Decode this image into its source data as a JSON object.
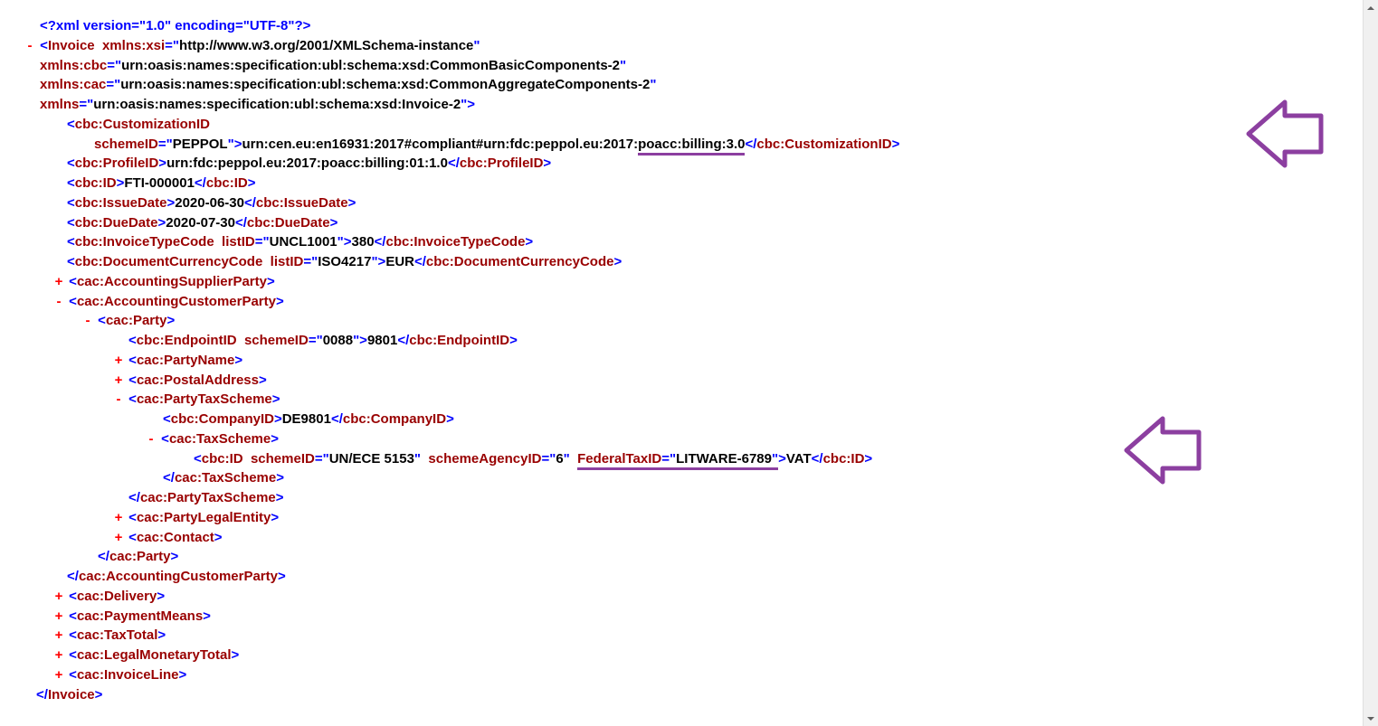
{
  "xml_decl": "<?xml version=\"1.0\" encoding=\"UTF-8\"?>",
  "root": {
    "name": "Invoice",
    "ns": {
      "xsi_attr": "xmlns:xsi",
      "xsi_val": "http://www.w3.org/2001/XMLSchema-instance",
      "cbc_attr": "xmlns:cbc",
      "cbc_val": "urn:oasis:names:specification:ubl:schema:xsd:CommonBasicComponents-2",
      "cac_attr": "xmlns:cac",
      "cac_val": "urn:oasis:names:specification:ubl:schema:xsd:CommonAggregateComponents-2",
      "xmlns_attr": "xmlns",
      "xmlns_val": "urn:oasis:names:specification:ubl:schema:xsd:Invoice-2"
    }
  },
  "customizationID": {
    "open": "cbc:CustomizationID",
    "schemeID_attr": "schemeID",
    "schemeID_val": "PEPPOL",
    "text_pre": "urn:cen.eu:en16931:2017#compliant#urn:fdc:peppol.eu:2017:",
    "text_hl": "poacc:billing:3.0",
    "close": "cbc:CustomizationID"
  },
  "profileID": {
    "tag": "cbc:ProfileID",
    "text": "urn:fdc:peppol.eu:2017:poacc:billing:01:1.0"
  },
  "id": {
    "tag": "cbc:ID",
    "text": "FTI-000001"
  },
  "issueDate": {
    "tag": "cbc:IssueDate",
    "text": "2020-06-30"
  },
  "dueDate": {
    "tag": "cbc:DueDate",
    "text": "2020-07-30"
  },
  "invoiceTypeCode": {
    "tag": "cbc:InvoiceTypeCode",
    "listID_attr": "listID",
    "listID_val": "UNCL1001",
    "text": "380"
  },
  "docCurrency": {
    "tag": "cbc:DocumentCurrencyCode",
    "listID_attr": "listID",
    "listID_val": "ISO4217",
    "text": "EUR"
  },
  "accountingSupplierParty": "cac:AccountingSupplierParty",
  "accountingCustomerParty": "cac:AccountingCustomerParty",
  "party": "cac:Party",
  "endpointID": {
    "tag": "cbc:EndpointID",
    "schemeID_attr": "schemeID",
    "schemeID_val": "0088",
    "text": "9801"
  },
  "partyName": "cac:PartyName",
  "postalAddress": "cac:PostalAddress",
  "partyTaxScheme": "cac:PartyTaxScheme",
  "companyID": {
    "tag": "cbc:CompanyID",
    "text": "DE9801"
  },
  "taxScheme": "cac:TaxScheme",
  "taxID": {
    "tag": "cbc:ID",
    "schemeID_attr": "schemeID",
    "schemeID_val": "UN/ECE 5153",
    "schemeAgencyID_attr": "schemeAgencyID",
    "schemeAgencyID_val": "6",
    "fedAttr": "FederalTaxID",
    "fedVal": "LITWARE-6789",
    "text": "VAT"
  },
  "partyLegalEntity": "cac:PartyLegalEntity",
  "contact": "cac:Contact",
  "delivery": "cac:Delivery",
  "paymentMeans": "cac:PaymentMeans",
  "taxTotal": "cac:TaxTotal",
  "legalMonetaryTotal": "cac:LegalMonetaryTotal",
  "invoiceLine": "cac:InvoiceLine"
}
